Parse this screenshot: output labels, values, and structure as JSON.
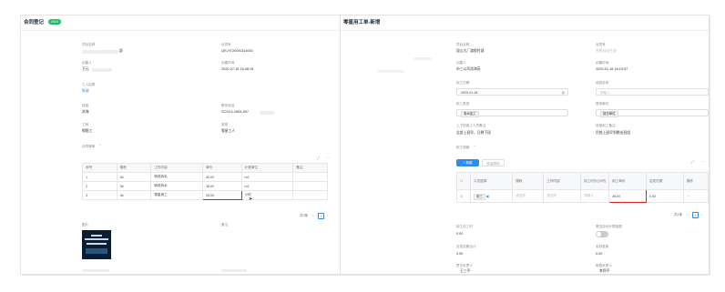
{
  "left": {
    "title": "合同登记",
    "badge": "2024",
    "fields": {
      "project_name_label": "项目名称",
      "project_name_value": "部",
      "contract_no_label": "合同号",
      "contract_no_value": "QR-HT20000116001",
      "creator_label": "创建人",
      "creator_value": "王元",
      "create_time_label": "创建时间",
      "create_time_value": "2020-07-18 15:48:19",
      "work_result_label": "工人结果",
      "work_result_value": "陈瑞",
      "team_label": "班组",
      "team_value": "滨海",
      "phone_label": "联系电话",
      "phone_value": "SCSC4-1894-897",
      "work_type_label": "工种",
      "work_type_value": "钢筋工",
      "type_label": "类型",
      "type_value": "零星工人",
      "section_label": "合同清单"
    },
    "table": {
      "headers": [
        "序号",
        "楼栋",
        "工作内容",
        "单价",
        "计费单位",
        "备注"
      ],
      "rows": [
        [
          "1",
          "3#",
          "转场拆毛",
          "40.00",
          "m2",
          ""
        ],
        [
          "2",
          "3#",
          "转场拆水",
          "18.00",
          "m2",
          ""
        ],
        [
          "3",
          "3#",
          "零星用工",
          "28.00",
          "小时",
          ""
        ]
      ]
    },
    "pagination": {
      "total": "共3条",
      "page": "1"
    },
    "image_label": "图片",
    "remark_label": "备注"
  },
  "right": {
    "title": "零星用工单-新增",
    "fields": {
      "project_name_label": "项目名称",
      "project_name_value": "昆山大厂渡假村部",
      "contract_no_label": "合同号",
      "contract_no_value": "系统自动生成",
      "creator_label": "创建人",
      "creator_value": "市三公司滨海苑",
      "create_time_label": "创建时间",
      "create_time_value": "2020-01-18 16:19:57",
      "work_date_label": "用工日期",
      "work_date_value": "2020-01-18",
      "team_label": "班组名称",
      "team_placeholder": "请输入",
      "work_type_label": "用工类型",
      "work_type_value": "零木加工",
      "unit_label": "费用单位",
      "unit_value": "按日单位",
      "source_label": "上下班用工人员备注",
      "source_value": "全部上班早，日晚下班",
      "remark_label": "班组用工备注",
      "remark_value": "目前上班早到晚出班组",
      "section_label": "用工明细"
    },
    "buttons": {
      "add": "+ 新增",
      "delete": "批量删除"
    },
    "table": {
      "headers": [
        "人员选择",
        "楼栋",
        "工作内容",
        "用工时长(小时)",
        "用工单价",
        "应发付费",
        "操作"
      ],
      "row": {
        "person": "张三",
        "building_placeholder": "请选择",
        "content_placeholder": "请选择",
        "hours_placeholder": "请输入",
        "price": "28.00",
        "amount": "0.00",
        "op": "···"
      }
    },
    "pagination": {
      "total": "共1条",
      "page": "1"
    },
    "summary": {
      "total_hours_label": "用工总工时",
      "total_hours_value": "0.00",
      "auto_label": "是否自动计算金额",
      "total_amount_label": "应发总额合计",
      "total_amount_value": "0.00",
      "actual_label": "实际费用",
      "actual_value": "0.00",
      "signer_label": "签字负责人",
      "signer_value": "王三平",
      "reviewer_label": "审核负责人",
      "reviewer_value": "李四平"
    }
  }
}
